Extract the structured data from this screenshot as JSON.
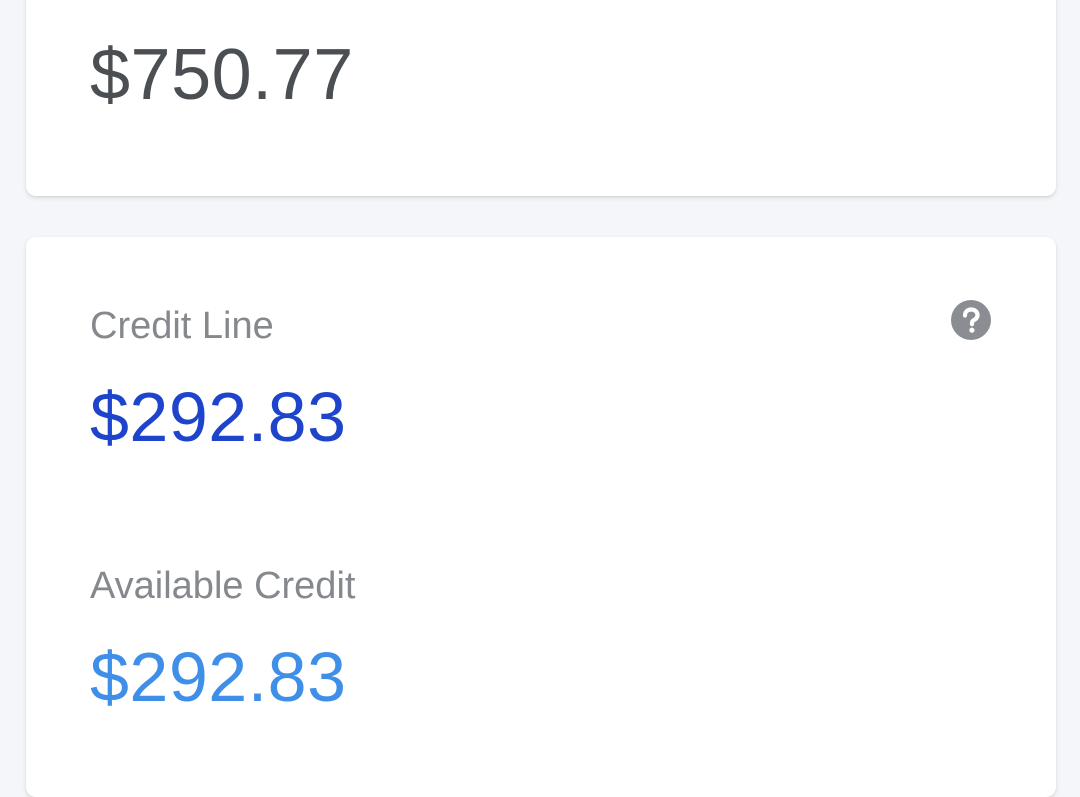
{
  "balance": {
    "amount": "$750.77"
  },
  "credit": {
    "credit_line_label": "Credit Line",
    "credit_line_amount": "$292.83",
    "available_label": "Available Credit",
    "available_amount": "$292.83",
    "help_icon": "question-circle-icon"
  },
  "colors": {
    "background": "#f4f6f9",
    "card": "#ffffff",
    "balance_text": "#4b4f53",
    "label_text": "#85898d",
    "credit_line_amount": "#1f44cc",
    "available_amount": "#3f8fe9",
    "help_icon": "#8a8e92"
  }
}
